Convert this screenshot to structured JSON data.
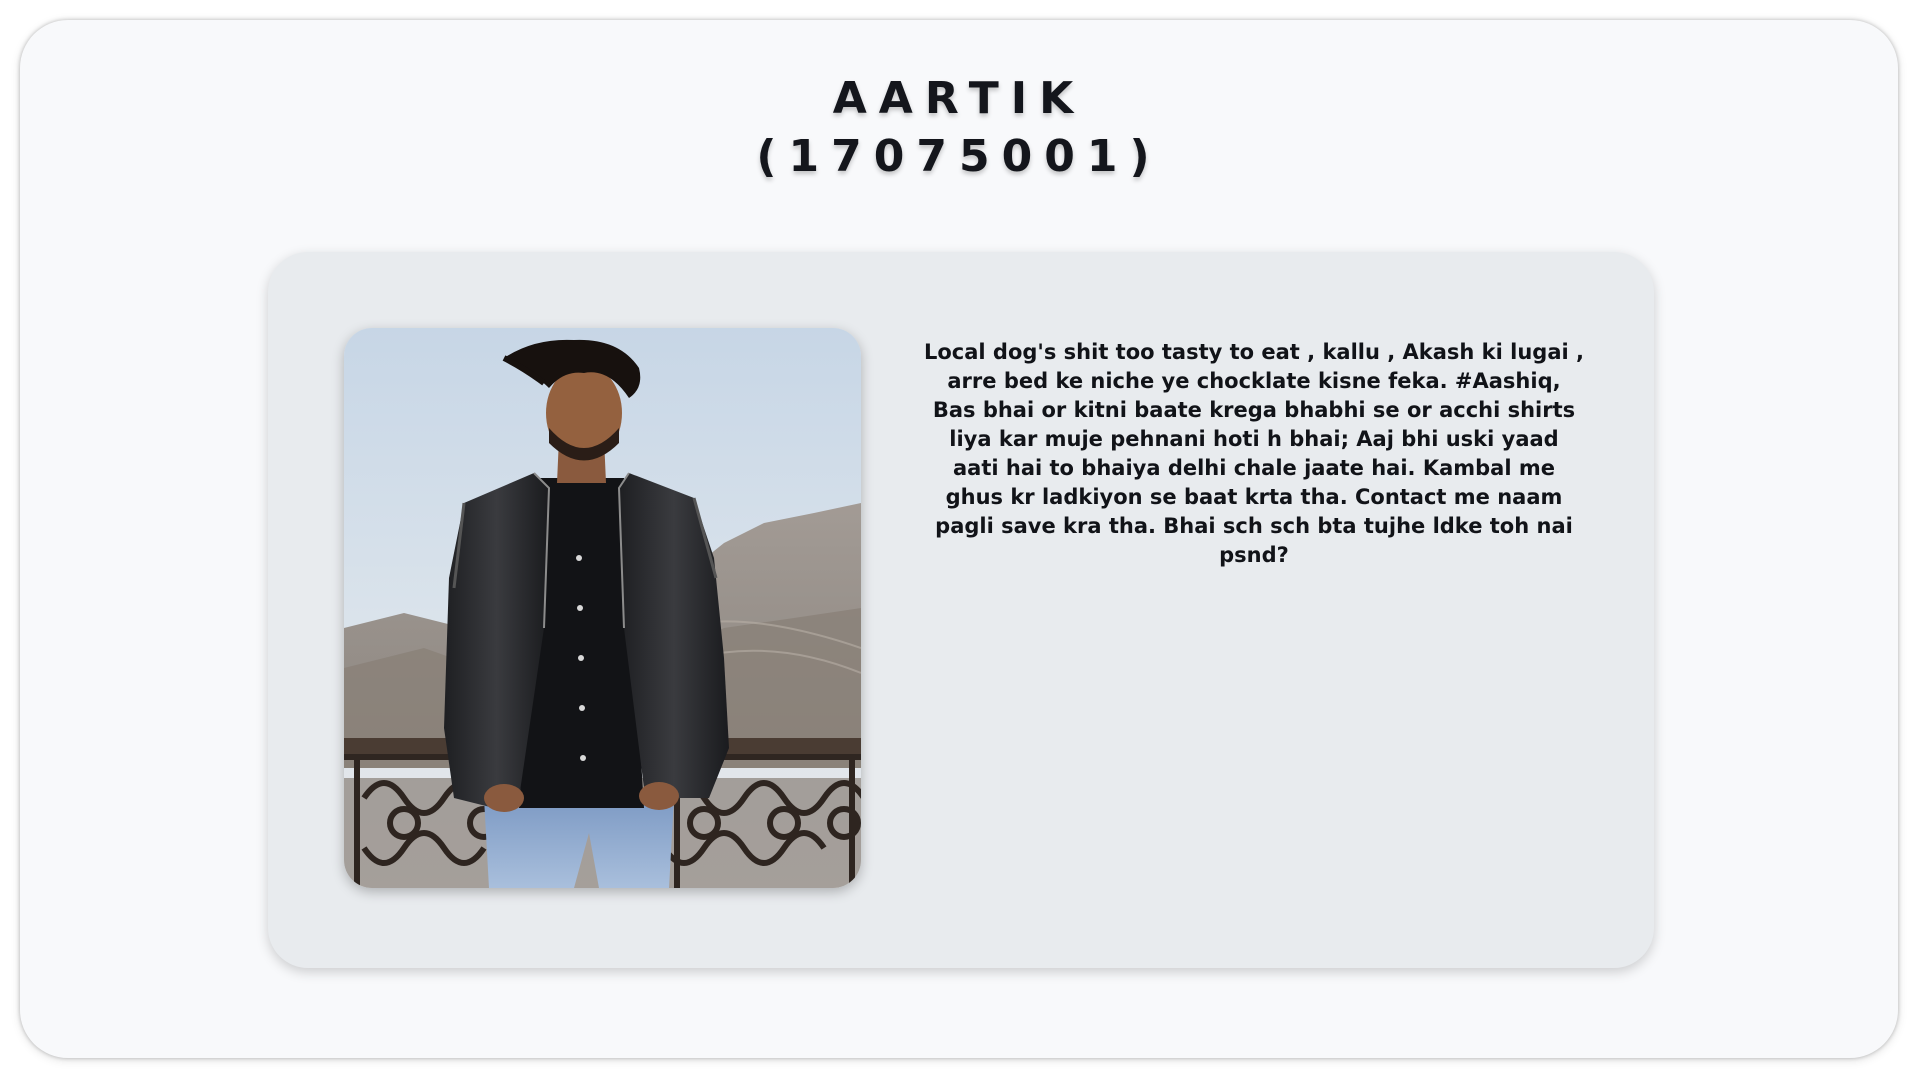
{
  "profile": {
    "name": "AARTIK",
    "id": "(17075001)",
    "bio": "Local dog's shit too tasty to eat , kallu , Akash ki lugai , arre bed ke niche ye chocklate kisne feka. #Aashiq, Bas bhai or kitni baate krega bhabhi se or acchi shirts liya kar muje pehnani hoti h bhai; Aaj bhi uski yaad aati hai to bhaiya delhi chale jaate hai. Kambal me ghus kr ladkiyon se baat krta tha. Contact me naam pagli save kra tha. Bhai sch sch bta tujhe ldke toh nai psnd?",
    "photo_icon": "portrait-photo"
  },
  "colors": {
    "page_bg": "#f8f9fb",
    "card_bg": "#e8ebee",
    "text": "#14161c"
  }
}
